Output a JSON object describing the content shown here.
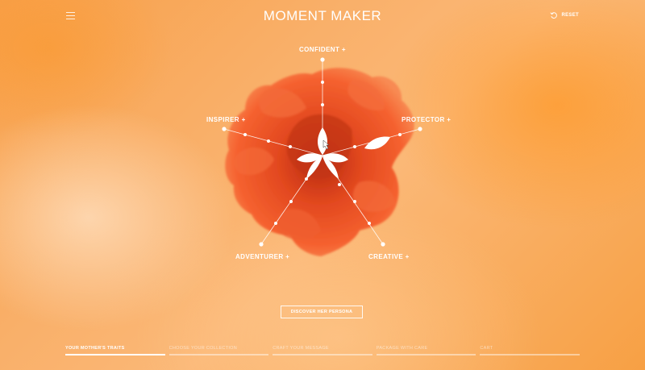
{
  "header": {
    "title": "MOMENT MAKER",
    "reset_label": "RESET"
  },
  "icons": {
    "menu": "hamburger-menu-icon",
    "reset": "rotate-ccw-icon",
    "cursor": "hand-pointer-icon"
  },
  "traits": {
    "confident": "CONFIDENT +",
    "inspirer": "INSPIRER +",
    "protector": "PROTECTOR +",
    "adventurer": "ADVENTURER +",
    "creative": "CREATIVE +"
  },
  "cta_label": "DISCOVER HER PERSONA",
  "steps": [
    {
      "label": "YOUR MOTHER'S TRAITS",
      "active": true
    },
    {
      "label": "CHOOSE YOUR COLLECTION",
      "active": false
    },
    {
      "label": "CRAFT YOUR MESSAGE",
      "active": false
    },
    {
      "label": "PACKAGE WITH CARE",
      "active": false
    },
    {
      "label": "CART",
      "active": false
    }
  ],
  "colors": {
    "background": "#f9b06a",
    "flower": "#f2562a",
    "flower_dark": "#c93515",
    "accent": "#ffffff"
  }
}
